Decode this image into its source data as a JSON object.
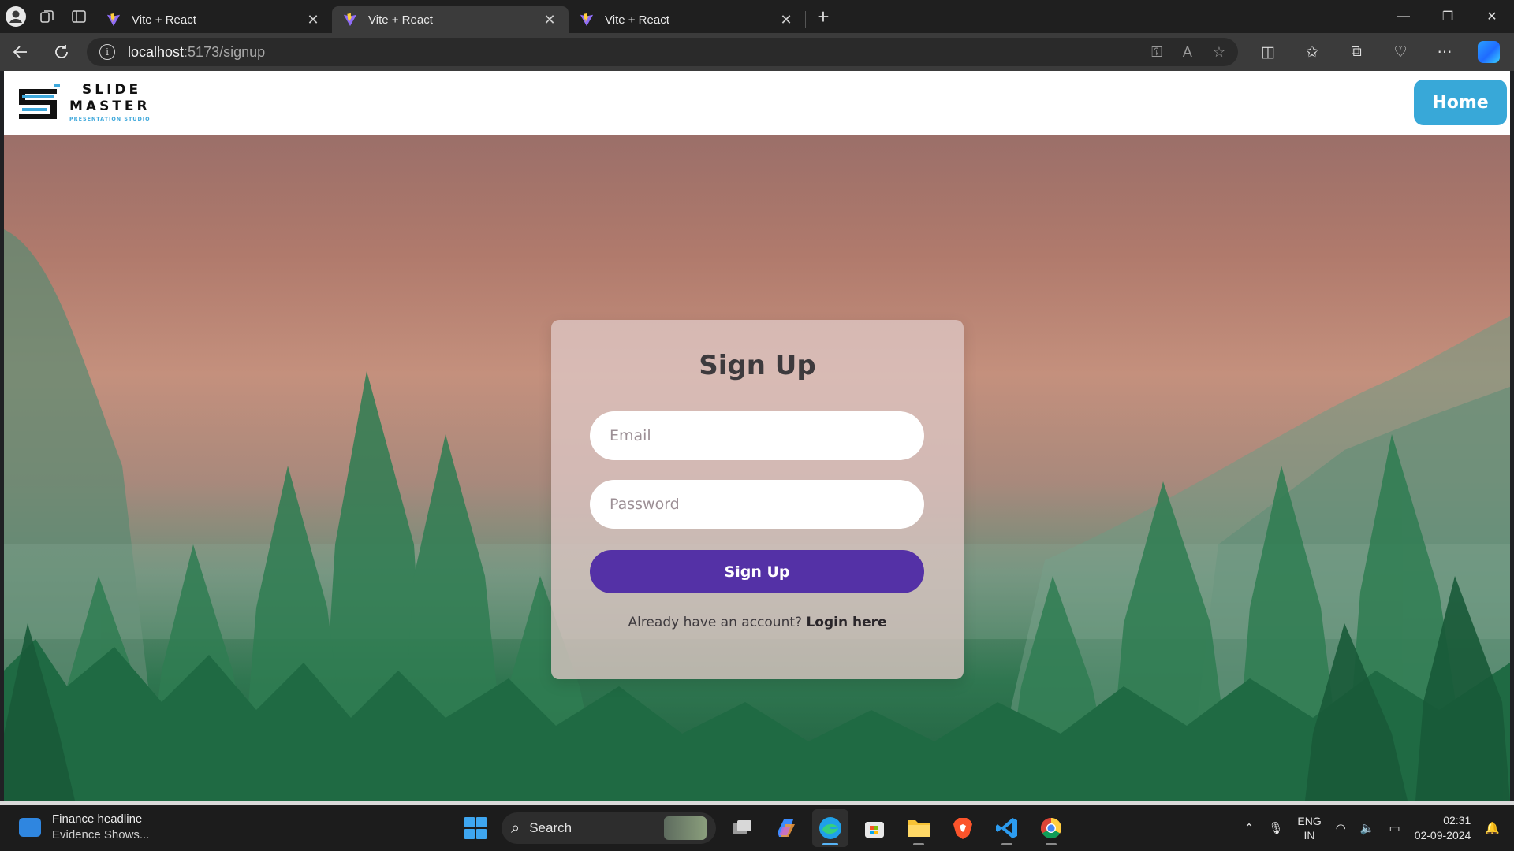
{
  "browser": {
    "tabs": [
      {
        "title": "Vite + React",
        "active": false
      },
      {
        "title": "Vite + React",
        "active": true
      },
      {
        "title": "Vite + React",
        "active": false
      }
    ],
    "url_host": "localhost",
    "url_path": ":5173/signup"
  },
  "site": {
    "logo_line1": "SLIDE",
    "logo_line2": "MASTER",
    "logo_line3": "PRESENTATION STUDIO",
    "home_label": "Home",
    "accent_color": "#38a8d8"
  },
  "form": {
    "title": "Sign Up",
    "email_placeholder": "Email",
    "password_placeholder": "Password",
    "submit_label": "Sign Up",
    "switch_text": "Already have an account?",
    "switch_link": "Login here",
    "submit_color": "#5431a6"
  },
  "taskbar": {
    "widget_title": "Finance headline",
    "widget_sub": "Evidence Shows...",
    "search_label": "Search",
    "lang_line1": "ENG",
    "lang_line2": "IN",
    "time": "02:31",
    "date": "02-09-2024"
  }
}
